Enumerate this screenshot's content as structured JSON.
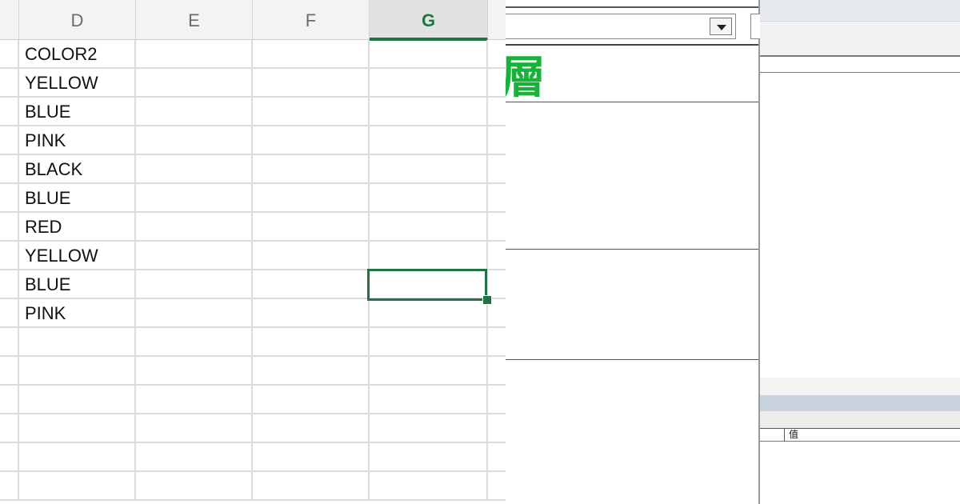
{
  "spreadsheet": {
    "columns": [
      {
        "label": "D",
        "active": false
      },
      {
        "label": "E",
        "active": false
      },
      {
        "label": "F",
        "active": false
      },
      {
        "label": "G",
        "active": true
      }
    ],
    "column_d_values": [
      "COLOR2",
      "YELLOW",
      "BLUE",
      "PINK",
      "BLACK",
      "BLUE",
      "RED",
      "YELLOW",
      "BLUE",
      "PINK"
    ],
    "accent_color": "#217346"
  },
  "middle_panel": {
    "heading_char": "層",
    "heading_color": "#16b23a",
    "dropdown_icon": "chevron-down-icon"
  },
  "right_panel": {
    "property_value_label": "值"
  }
}
